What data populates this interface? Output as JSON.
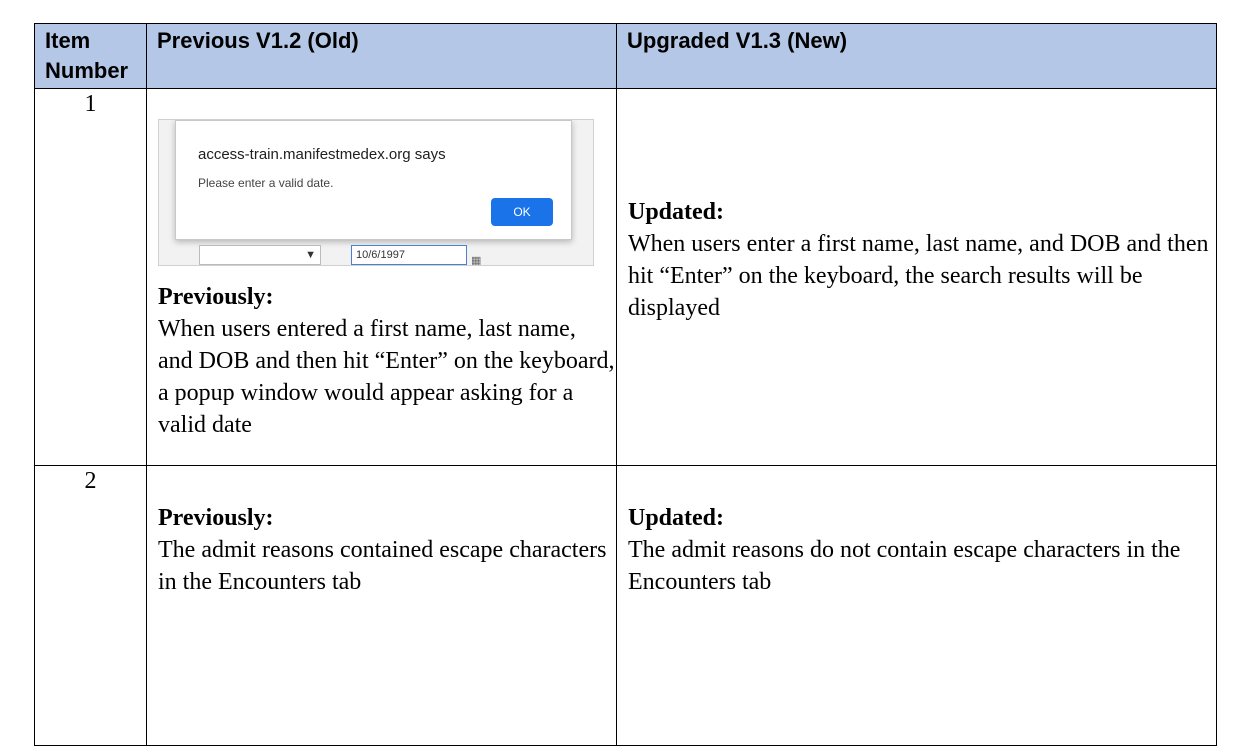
{
  "table": {
    "headers": [
      "Item Number",
      "Previous V1.2 (Old)",
      "Upgraded V1.3 (New)"
    ],
    "rows": [
      {
        "number": "1",
        "dialog": {
          "title": "access-train.manifestmedex.org says",
          "message": "Please enter a valid date.",
          "ok_label": "OK",
          "date_value": "10/6/1997"
        },
        "previous_label": "Previously:",
        "previous_text": "When users entered a first name, last name, and DOB and then hit “Enter” on the keyboard, a popup window would appear asking for a valid date",
        "updated_label": "Updated:",
        "updated_text": "When users enter a first name, last name, and DOB and then hit “Enter” on the keyboard, the search results will be displayed"
      },
      {
        "number": "2",
        "previous_label": "Previously:",
        "previous_text": "The admit reasons contained escape characters in the Encounters tab",
        "updated_label": "Updated:",
        "updated_text": "The admit reasons do not contain escape characters in the Encounters tab"
      }
    ]
  }
}
